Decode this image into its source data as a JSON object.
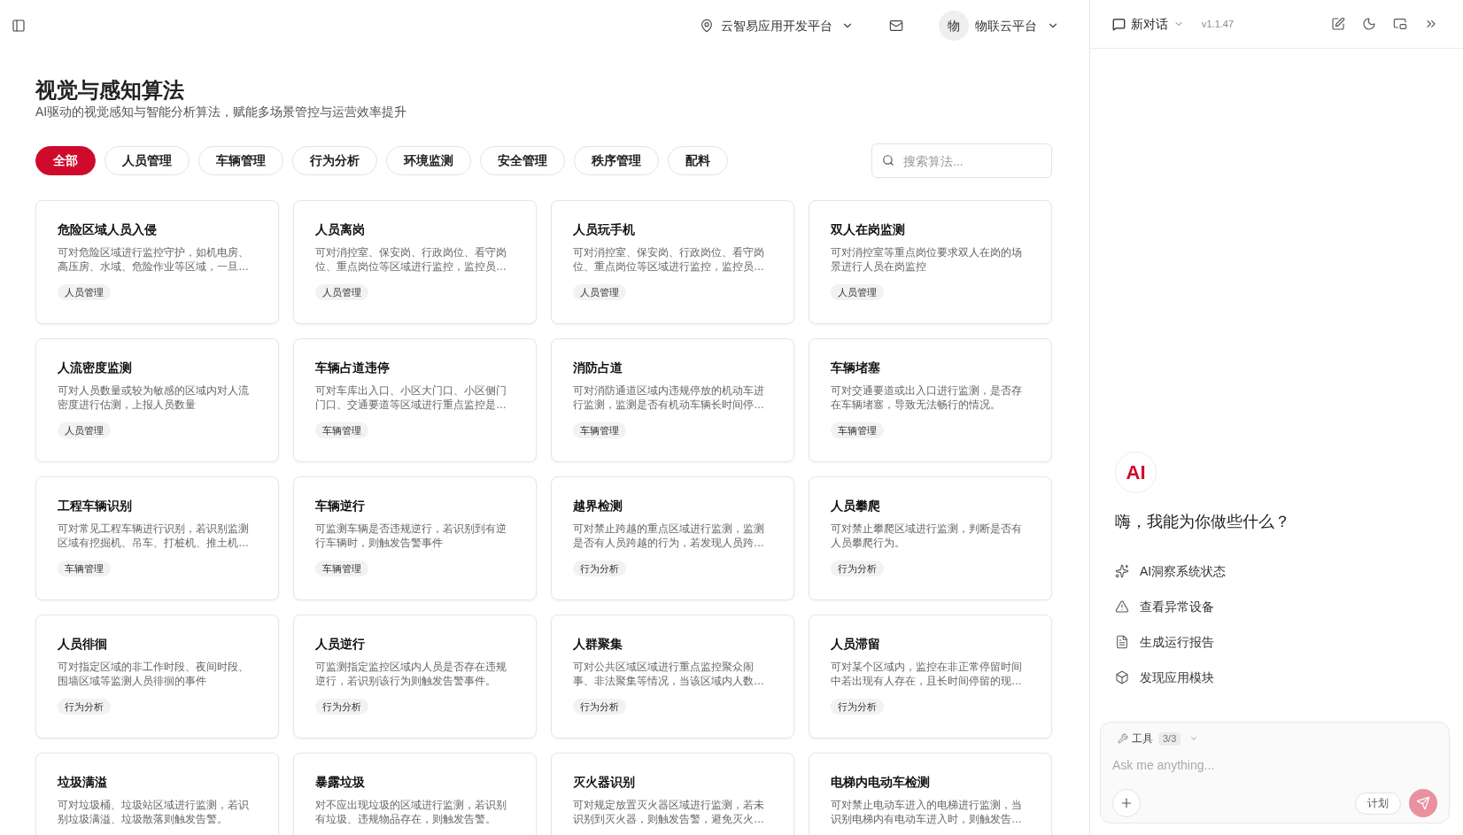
{
  "header": {
    "location": "云智易应用开发平台",
    "user": {
      "avatar_text": "物",
      "name": "物联云平台"
    }
  },
  "page": {
    "title": "视觉与感知算法",
    "subtitle": "AI驱动的视觉感知与智能分析算法，赋能多场景管控与运营效率提升"
  },
  "tabs": [
    {
      "label": "全部",
      "selected": true
    },
    {
      "label": "人员管理",
      "selected": false
    },
    {
      "label": "车辆管理",
      "selected": false
    },
    {
      "label": "行为分析",
      "selected": false
    },
    {
      "label": "环境监测",
      "selected": false
    },
    {
      "label": "安全管理",
      "selected": false
    },
    {
      "label": "秩序管理",
      "selected": false
    },
    {
      "label": "配料",
      "selected": false
    }
  ],
  "search": {
    "placeholder": "搜索算法..."
  },
  "cards": [
    {
      "title": "危险区域人员入侵",
      "description": "可对危险区域进行监控守护，如机电房、高压房、水域、危险作业等区域，一旦…",
      "tag": "人员管理"
    },
    {
      "title": "人员离岗",
      "description": "可对消控室、保安岗、行政岗位、看守岗位、重点岗位等区域进行监控，监控员…",
      "tag": "人员管理"
    },
    {
      "title": "人员玩手机",
      "description": "可对消控室、保安岗、行政岗位、看守岗位、重点岗位等区域进行监控，监控员…",
      "tag": "人员管理"
    },
    {
      "title": "双人在岗监测",
      "description": "可对消控室等重点岗位要求双人在岗的场景进行人员在岗监控",
      "tag": "人员管理"
    },
    {
      "title": "人流密度监测",
      "description": "可对人员数量或较为敏感的区域内对人流密度进行估测，上报人员数量",
      "tag": "人员管理"
    },
    {
      "title": "车辆占道违停",
      "description": "可对车库出入口、小区大门口、小区侧门门口、交通要道等区域进行重点监控是…",
      "tag": "车辆管理"
    },
    {
      "title": "消防占道",
      "description": "可对消防通道区域内违规停放的机动车进行监测，监测是否有机动车辆长时间停…",
      "tag": "车辆管理"
    },
    {
      "title": "车辆堵塞",
      "description": "可对交通要道或出入口进行监测，是否存在车辆堵塞，导致无法畅行的情况。",
      "tag": "车辆管理"
    },
    {
      "title": "工程车辆识别",
      "description": "可对常见工程车辆进行识别，若识别监测区域有挖掘机、吊车、打桩机、推土机…",
      "tag": "车辆管理"
    },
    {
      "title": "车辆逆行",
      "description": "可监测车辆是否违规逆行，若识别到有逆行车辆时，则触发告警事件",
      "tag": "车辆管理"
    },
    {
      "title": "越界检测",
      "description": "可对禁止跨越的重点区域进行监测，监测是否有人员跨越的行为，若发现人员跨…",
      "tag": "行为分析"
    },
    {
      "title": "人员攀爬",
      "description": "可对禁止攀爬区域进行监测，判断是否有人员攀爬行为。",
      "tag": "行为分析"
    },
    {
      "title": "人员徘徊",
      "description": "可对指定区域的非工作时段、夜间时段、围墙区域等监测人员徘徊的事件",
      "tag": "行为分析"
    },
    {
      "title": "人员逆行",
      "description": "可监测指定监控区域内人员是否存在违规逆行，若识别该行为则触发告警事件。",
      "tag": "行为分析"
    },
    {
      "title": "人群聚集",
      "description": "可对公共区域区域进行重点监控聚众闹事、非法聚集等情况，当该区域内人数…",
      "tag": "行为分析"
    },
    {
      "title": "人员滞留",
      "description": "可对某个区域内，监控在非正常停留时间中若出现有人存在，且长时间停留的现…",
      "tag": "行为分析"
    },
    {
      "title": "垃圾满溢",
      "description": "可对垃圾桶、垃圾站区域进行监测，若识别垃圾满溢、垃圾散落则触发告警。"
    },
    {
      "title": "暴露垃圾",
      "description": "对不应出现垃圾的区域进行监测，若识别有垃圾、违规物品存在，则触发告警。"
    },
    {
      "title": "灭火器识别",
      "description": "可对规定放置灭火器区域进行监测，若未识别到灭火器，则触发告警，避免灭火…"
    },
    {
      "title": "电梯内电动车检测",
      "description": "可对禁止电动车进入的电梯进行监测，当识别电梯内有电动车进入时，则触发告…"
    }
  ],
  "assistant": {
    "header": {
      "title": "新对话",
      "version": "v1.1.47"
    },
    "logo_text": "AI",
    "greeting": "嗨，我能为你做些什么？",
    "suggestions": [
      {
        "label": "AI洞察系统状态"
      },
      {
        "label": "查看异常设备"
      },
      {
        "label": "生成运行报告"
      },
      {
        "label": "发现应用模块"
      }
    ],
    "composer": {
      "tools_label": "工具",
      "tools_count": "3/3",
      "placeholder": "Ask me anything...",
      "plan_label": "计划",
      "send": {
        "disabled": true
      }
    }
  }
}
